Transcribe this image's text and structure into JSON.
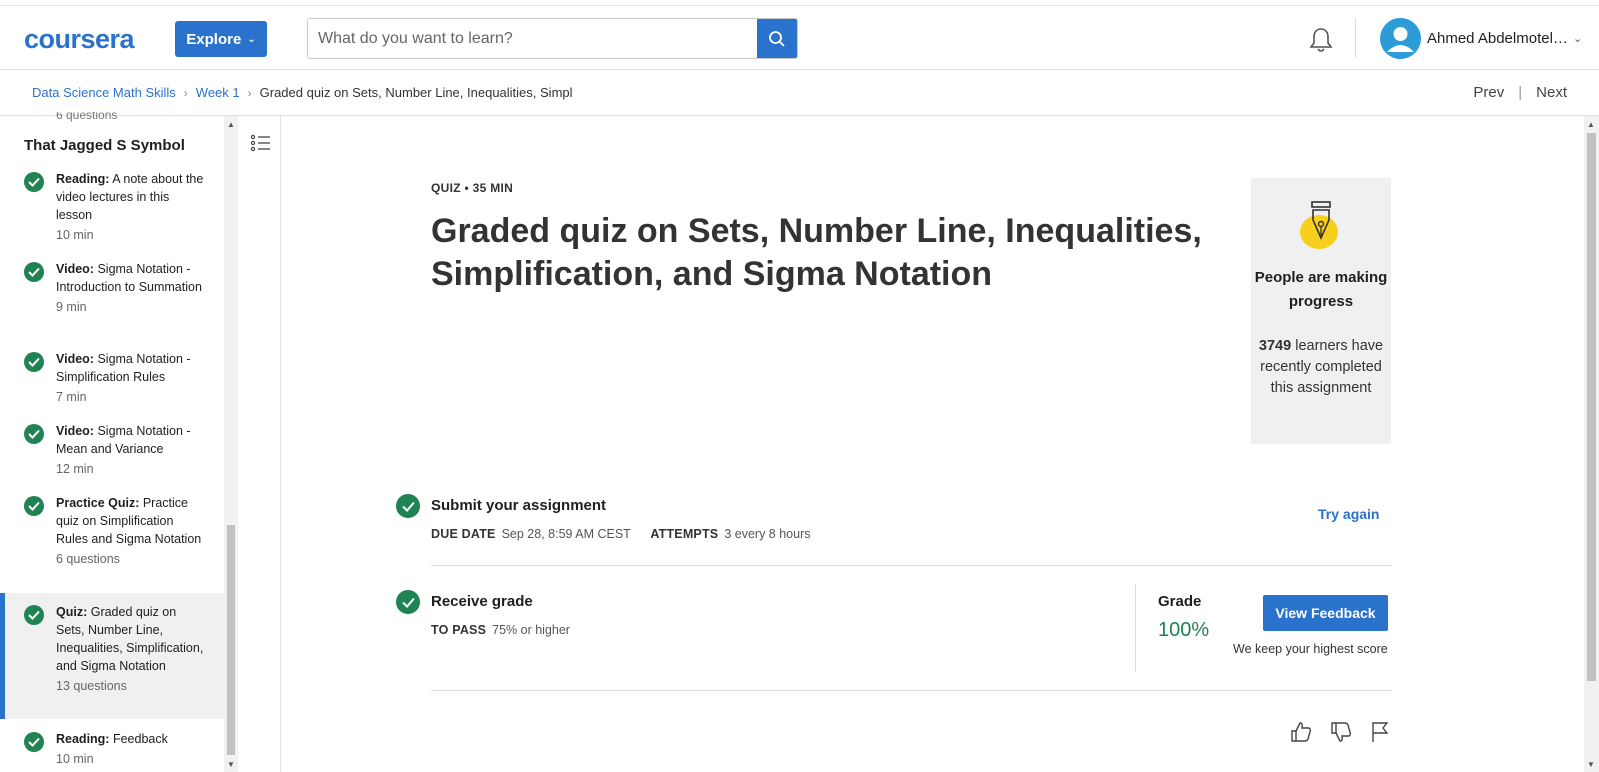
{
  "header": {
    "logo": "coursera",
    "explore_label": "Explore",
    "search_placeholder": "What do you want to learn?",
    "user_name": "Ahmed Abdelmotel…",
    "brand_color": "#2a73cc"
  },
  "breadcrumb": {
    "items": [
      "Data Science Math Skills",
      "Week 1",
      "Graded quiz on Sets, Number Line, Inequalities, Simpl"
    ],
    "prev": "Prev",
    "separator": "|",
    "next": "Next"
  },
  "sidebar": {
    "cut_text": "6 questions",
    "section_title": "That Jagged S Symbol",
    "items": [
      {
        "type": "Reading:",
        "title": " A note about the video lectures in this lesson",
        "duration": "10 min"
      },
      {
        "type": "Video:",
        "title": " Sigma Notation - Introduction to Summation",
        "duration": "9 min"
      },
      {
        "type": "Video:",
        "title": " Sigma Notation - Simplification Rules",
        "duration": "7 min"
      },
      {
        "type": "Video:",
        "title": " Sigma Notation - Mean and Variance",
        "duration": "12 min"
      },
      {
        "type": "Practice Quiz:",
        "title": " Practice quiz on Simplification Rules and Sigma Notation",
        "duration": "6 questions"
      },
      {
        "type": "Quiz:",
        "title": " Graded quiz on Sets, Number Line, Inequalities, Simplification, and Sigma Notation",
        "duration": "13 questions"
      },
      {
        "type": "Reading:",
        "title": " Feedback",
        "duration": "10 min"
      }
    ]
  },
  "main": {
    "quiz_label": "QUIZ • 35 MIN",
    "title": "Graded quiz on Sets, Number Line, Inequalities, Simplification, and Sigma Notation",
    "progress_card": {
      "heading": "People are making progress",
      "count": "3749",
      "body": " learners have recently completed this assignment"
    },
    "submit": {
      "title": "Submit your assignment",
      "due_label": "DUE DATE",
      "due_value": "Sep 28, 8:59 AM CEST",
      "attempts_label": "ATTEMPTS",
      "attempts_value": "3 every 8 hours",
      "try_again": "Try again"
    },
    "receive": {
      "title": "Receive grade",
      "pass_label": "TO PASS",
      "pass_value": "75% or higher",
      "grade_label": "Grade",
      "grade_value": "100%",
      "view_feedback": "View Feedback",
      "keep_score": "We keep your highest score"
    },
    "success_color": "#1f8354"
  }
}
